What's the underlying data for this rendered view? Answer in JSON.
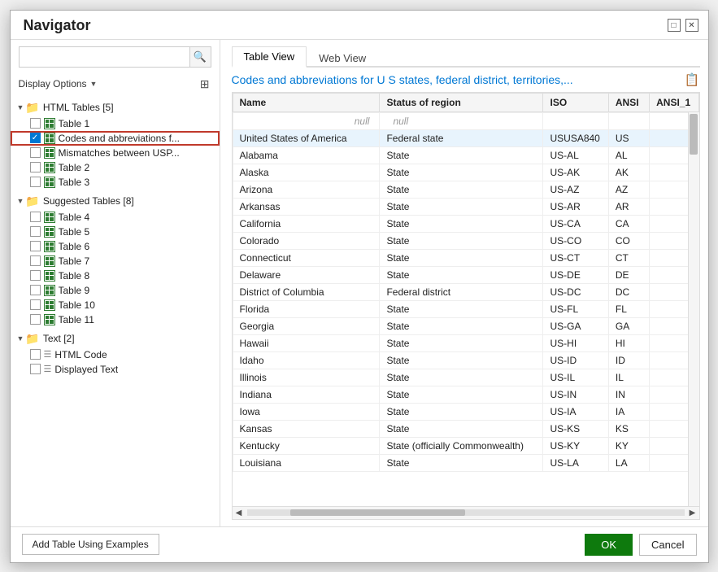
{
  "dialog": {
    "title": "Navigator",
    "title_btn_restore": "□",
    "title_btn_close": "✕"
  },
  "search": {
    "placeholder": "",
    "icon": "🔍"
  },
  "display_options": {
    "label": "Display Options",
    "arrow": "▼"
  },
  "tree": {
    "html_tables_group": "HTML Tables [5]",
    "suggested_tables_group": "Suggested Tables [8]",
    "text_group": "Text [2]",
    "items": [
      {
        "id": "table1",
        "label": "Table 1",
        "indent": 2,
        "type": "table",
        "checked": false
      },
      {
        "id": "codes",
        "label": "Codes and abbreviations f...",
        "indent": 2,
        "type": "table",
        "checked": true,
        "selected": true
      },
      {
        "id": "mismatches",
        "label": "Mismatches between USP...",
        "indent": 2,
        "type": "table",
        "checked": false
      },
      {
        "id": "table2",
        "label": "Table 2",
        "indent": 2,
        "type": "table",
        "checked": false
      },
      {
        "id": "table3",
        "label": "Table 3",
        "indent": 2,
        "type": "table",
        "checked": false
      },
      {
        "id": "table4",
        "label": "Table 4",
        "indent": 2,
        "type": "table",
        "checked": false,
        "group": "suggested"
      },
      {
        "id": "table5",
        "label": "Table 5",
        "indent": 2,
        "type": "table",
        "checked": false,
        "group": "suggested"
      },
      {
        "id": "table6",
        "label": "Table 6",
        "indent": 2,
        "type": "table",
        "checked": false,
        "group": "suggested"
      },
      {
        "id": "table7",
        "label": "Table 7",
        "indent": 2,
        "type": "table",
        "checked": false,
        "group": "suggested"
      },
      {
        "id": "table8",
        "label": "Table 8",
        "indent": 2,
        "type": "table",
        "checked": false,
        "group": "suggested"
      },
      {
        "id": "table9",
        "label": "Table 9",
        "indent": 2,
        "type": "table",
        "checked": false,
        "group": "suggested"
      },
      {
        "id": "table10",
        "label": "Table 10",
        "indent": 2,
        "type": "table",
        "checked": false,
        "group": "suggested"
      },
      {
        "id": "table11",
        "label": "Table 11",
        "indent": 2,
        "type": "table",
        "checked": false,
        "group": "suggested"
      },
      {
        "id": "htmlcode",
        "label": "HTML Code",
        "indent": 2,
        "type": "html",
        "checked": false,
        "group": "text"
      },
      {
        "id": "displayedtext",
        "label": "Displayed Text",
        "indent": 2,
        "type": "html",
        "checked": false,
        "group": "text"
      }
    ]
  },
  "tabs": [
    {
      "id": "table-view",
      "label": "Table View",
      "active": true
    },
    {
      "id": "web-view",
      "label": "Web View",
      "active": false
    }
  ],
  "preview": {
    "title": "Codes and abbreviations for U S states, federal district, territories,...",
    "columns": [
      "Name",
      "Status of region",
      "ISO",
      "ANSI",
      "ANSI_1"
    ],
    "null_label": "null",
    "rows": [
      [
        "United States of America",
        "Federal state",
        "USUSA840",
        "US",
        ""
      ],
      [
        "Alabama",
        "State",
        "US-AL",
        "AL",
        ""
      ],
      [
        "Alaska",
        "State",
        "US-AK",
        "AK",
        ""
      ],
      [
        "Arizona",
        "State",
        "US-AZ",
        "AZ",
        ""
      ],
      [
        "Arkansas",
        "State",
        "US-AR",
        "AR",
        ""
      ],
      [
        "California",
        "State",
        "US-CA",
        "CA",
        ""
      ],
      [
        "Colorado",
        "State",
        "US-CO",
        "CO",
        ""
      ],
      [
        "Connecticut",
        "State",
        "US-CT",
        "CT",
        ""
      ],
      [
        "Delaware",
        "State",
        "US-DE",
        "DE",
        ""
      ],
      [
        "District of Columbia",
        "Federal district",
        "US-DC",
        "DC",
        ""
      ],
      [
        "Florida",
        "State",
        "US-FL",
        "FL",
        ""
      ],
      [
        "Georgia",
        "State",
        "US-GA",
        "GA",
        ""
      ],
      [
        "Hawaii",
        "State",
        "US-HI",
        "HI",
        ""
      ],
      [
        "Idaho",
        "State",
        "US-ID",
        "ID",
        ""
      ],
      [
        "Illinois",
        "State",
        "US-IL",
        "IL",
        ""
      ],
      [
        "Indiana",
        "State",
        "US-IN",
        "IN",
        ""
      ],
      [
        "Iowa",
        "State",
        "US-IA",
        "IA",
        ""
      ],
      [
        "Kansas",
        "State",
        "US-KS",
        "KS",
        ""
      ],
      [
        "Kentucky",
        "State (officially Commonwealth)",
        "US-KY",
        "KY",
        ""
      ],
      [
        "Louisiana",
        "State",
        "US-LA",
        "LA",
        ""
      ]
    ]
  },
  "footer": {
    "add_examples_label": "Add Table Using Examples",
    "ok_label": "OK",
    "cancel_label": "Cancel"
  }
}
